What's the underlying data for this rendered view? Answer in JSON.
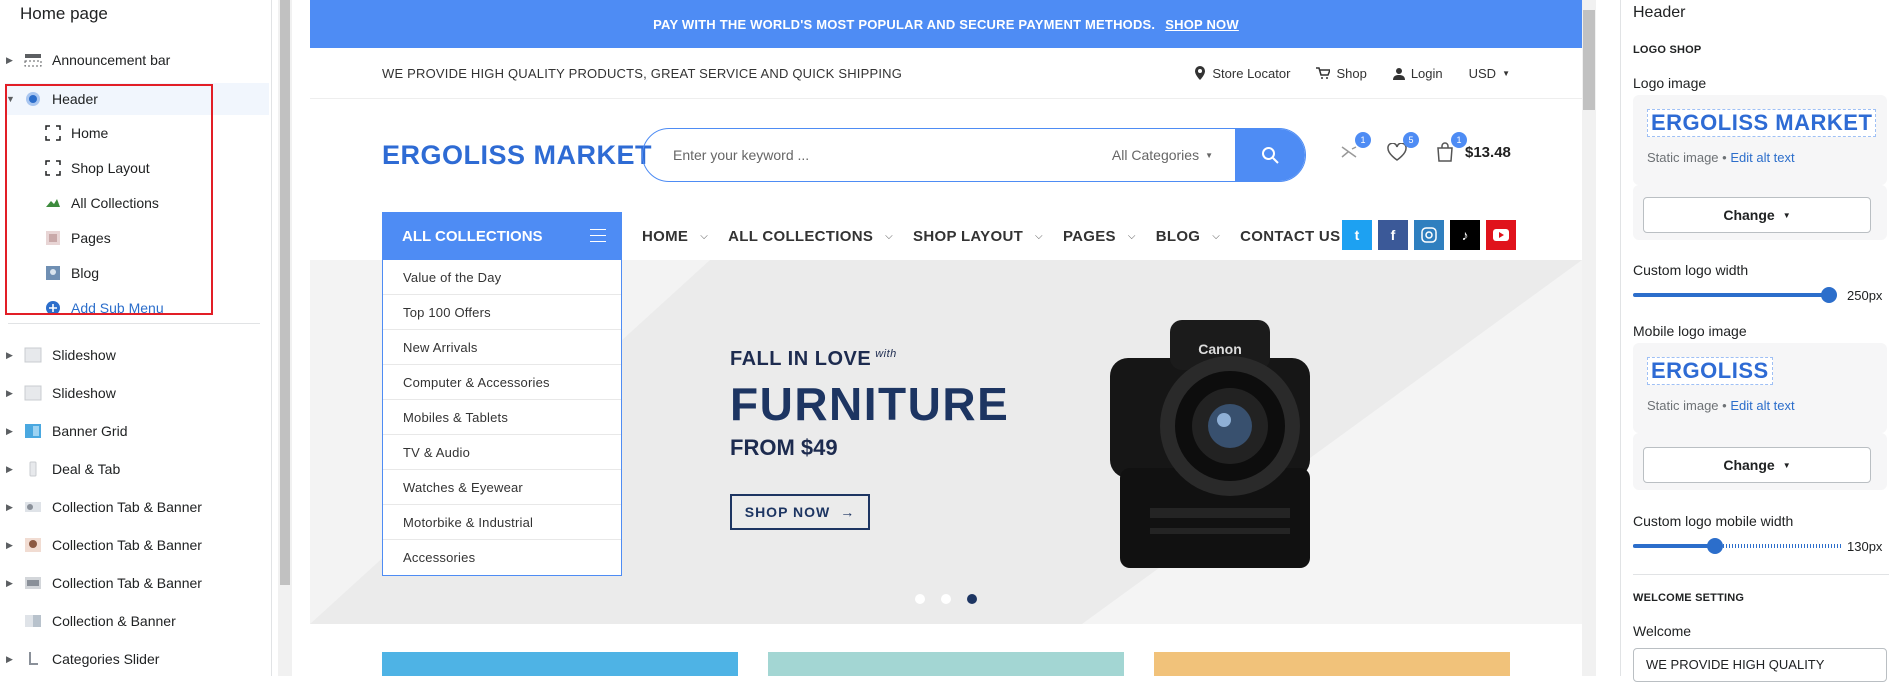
{
  "left_panel": {
    "title": "Home page",
    "items": [
      {
        "label": "Announcement bar",
        "icon": "layout-icon"
      },
      {
        "label": "Header",
        "icon": "header-icon"
      },
      {
        "label": "Slideshow",
        "icon": "slideshow-icon"
      },
      {
        "label": "Slideshow",
        "icon": "slideshow-icon"
      },
      {
        "label": "Banner Grid",
        "icon": "banner-grid-icon"
      },
      {
        "label": "Deal & Tab",
        "icon": "deal-icon"
      },
      {
        "label": "Collection Tab & Banner",
        "icon": "collection-icon"
      },
      {
        "label": "Collection Tab & Banner",
        "icon": "collection-icon"
      },
      {
        "label": "Collection Tab & Banner",
        "icon": "collection-icon"
      },
      {
        "label": "Collection & Banner",
        "icon": "collection-icon"
      },
      {
        "label": "Categories Slider",
        "icon": "slider-icon"
      }
    ],
    "header_children": [
      {
        "label": "Home",
        "icon": "menu-item-icon"
      },
      {
        "label": "Shop Layout",
        "icon": "menu-item-icon"
      },
      {
        "label": "All Collections",
        "icon": "collection-thumb-icon"
      },
      {
        "label": "Pages",
        "icon": "page-thumb-icon"
      },
      {
        "label": "Blog",
        "icon": "blog-thumb-icon"
      },
      {
        "label": "Add Sub Menu",
        "icon": "plus-circle-icon"
      }
    ]
  },
  "preview": {
    "announcement": {
      "text": "PAY WITH THE WORLD'S MOST POPULAR AND SECURE PAYMENT METHODS.",
      "link": "SHOP NOW"
    },
    "topbar": {
      "welcome": "WE PROVIDE HIGH QUALITY PRODUCTS, GREAT SERVICE AND QUICK SHIPPING",
      "store_locator": "Store Locator",
      "shop": "Shop",
      "login": "Login",
      "currency": "USD"
    },
    "logo": "ERGOLISS MARKET",
    "search": {
      "placeholder": "Enter your keyword ...",
      "category": "All Categories"
    },
    "badges": {
      "compare": "1",
      "wishlist": "5",
      "cart": "1"
    },
    "cart_total": "$13.48",
    "all_collections": "ALL COLLECTIONS",
    "menu": [
      {
        "label": "HOME",
        "has_dropdown": true
      },
      {
        "label": "ALL COLLECTIONS",
        "has_dropdown": true
      },
      {
        "label": "SHOP LAYOUT",
        "has_dropdown": true
      },
      {
        "label": "PAGES",
        "has_dropdown": true
      },
      {
        "label": "BLOG",
        "has_dropdown": true
      },
      {
        "label": "CONTACT US",
        "has_dropdown": false
      }
    ],
    "socials": [
      {
        "icon": "twitter-icon",
        "color": "#1da1f2"
      },
      {
        "icon": "facebook-icon",
        "color": "#3b5998"
      },
      {
        "icon": "instagram-icon",
        "color": "#2f7fbf"
      },
      {
        "icon": "tiktok-icon",
        "color": "#000000"
      },
      {
        "icon": "youtube-icon",
        "color": "#e0121b"
      }
    ],
    "categories": [
      "Value of the Day",
      "Top 100 Offers",
      "New Arrivals",
      "Computer & Accessories",
      "Mobiles & Tablets",
      "TV & Audio",
      "Watches & Eyewear",
      "Motorbike & Industrial",
      "Accessories"
    ],
    "hero": {
      "line1": "FALL IN LOVE",
      "line1_small": "with",
      "line2": "FURNITURE",
      "line3": "FROM $49",
      "cta": "SHOP NOW",
      "camera_brand": "Canon"
    },
    "accent_color": "#4e8cf4"
  },
  "right_panel": {
    "title": "Header",
    "logo_section": "LOGO SHOP",
    "logo_image_label": "Logo image",
    "logo_preview": "ERGOLISS MARKET",
    "static_image": "Static image •",
    "edit_alt": "Edit alt text",
    "change_label": "Change",
    "custom_logo_width_label": "Custom logo width",
    "custom_logo_width_value": "250px",
    "mobile_logo_label": "Mobile logo image",
    "mobile_logo_preview": "ERGOLISS",
    "custom_mobile_width_label": "Custom logo mobile width",
    "custom_mobile_width_value": "130px",
    "welcome_section": "WELCOME SETTING",
    "welcome_label": "Welcome",
    "welcome_value": "WE PROVIDE HIGH QUALITY"
  }
}
